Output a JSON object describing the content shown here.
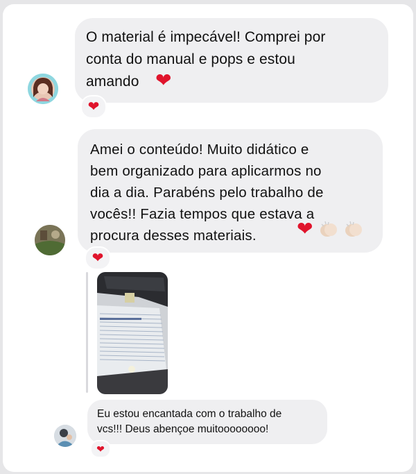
{
  "messages": [
    {
      "text": "O material é impecável! Comprei por\nconta do manual e pops e estou\namando",
      "reaction": "❤"
    },
    {
      "text": "Amei o conteúdo! Muito didático e\nbem organizado para aplicarmos no\ndia a dia. Parabéns pelo trabalho de\nvocês!! Fazia tempos que estava a\nprocura desses materiais.",
      "reaction": "❤"
    },
    {
      "text": "Eu estou encantada com o trabalho de\nvcs!!! Deus abençoe muitoooooooo!",
      "reaction": "❤"
    }
  ],
  "icons": {
    "heart": "❤",
    "clap": "clapping-hands-icon"
  },
  "colors": {
    "bubble": "#efeff1",
    "heart": "#e0142c",
    "background": "#ffffff"
  }
}
